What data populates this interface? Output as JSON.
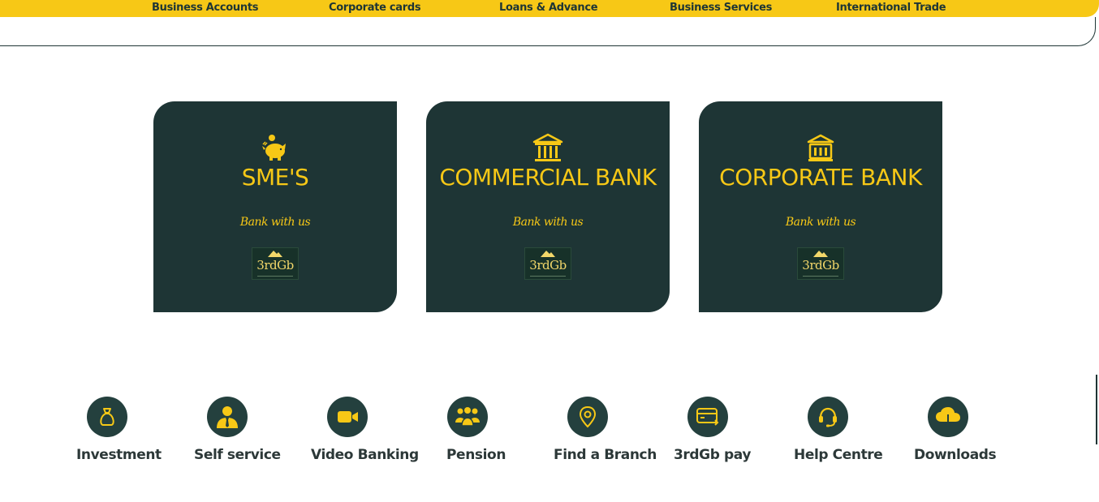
{
  "nav": {
    "items": [
      {
        "label": "Business Accounts"
      },
      {
        "label": "Corporate cards"
      },
      {
        "label": "Loans & Advance"
      },
      {
        "label": "Business Services"
      },
      {
        "label": "International Trade"
      }
    ]
  },
  "cards": [
    {
      "icon": "piggy-bank-icon",
      "title": "SME'S",
      "tagline": "Bank with us",
      "logo_text": "3rdGb"
    },
    {
      "icon": "bank-building-icon",
      "title": "COMMERCIAL BANK",
      "tagline": "Bank with us",
      "logo_text": "3rdGb"
    },
    {
      "icon": "bank-building-icon",
      "title": "CORPORATE BANK",
      "tagline": "Bank with us",
      "logo_text": "3rdGb"
    }
  ],
  "quick_links": [
    {
      "icon": "money-bag-icon",
      "label": "Investment"
    },
    {
      "icon": "person-tie-icon",
      "label": "Self service"
    },
    {
      "icon": "video-camera-icon",
      "label": "Video Banking"
    },
    {
      "icon": "people-group-icon",
      "label": "Pension"
    },
    {
      "icon": "location-pin-icon",
      "label": "Find a Branch"
    },
    {
      "icon": "card-transfer-icon",
      "label": "3rdGb pay"
    },
    {
      "icon": "headset-icon",
      "label": "Help Centre"
    },
    {
      "icon": "cloud-download-icon",
      "label": "Downloads"
    }
  ],
  "colors": {
    "accent": "#f7c816",
    "dark": "#1e3535",
    "label": "#2c3838"
  }
}
